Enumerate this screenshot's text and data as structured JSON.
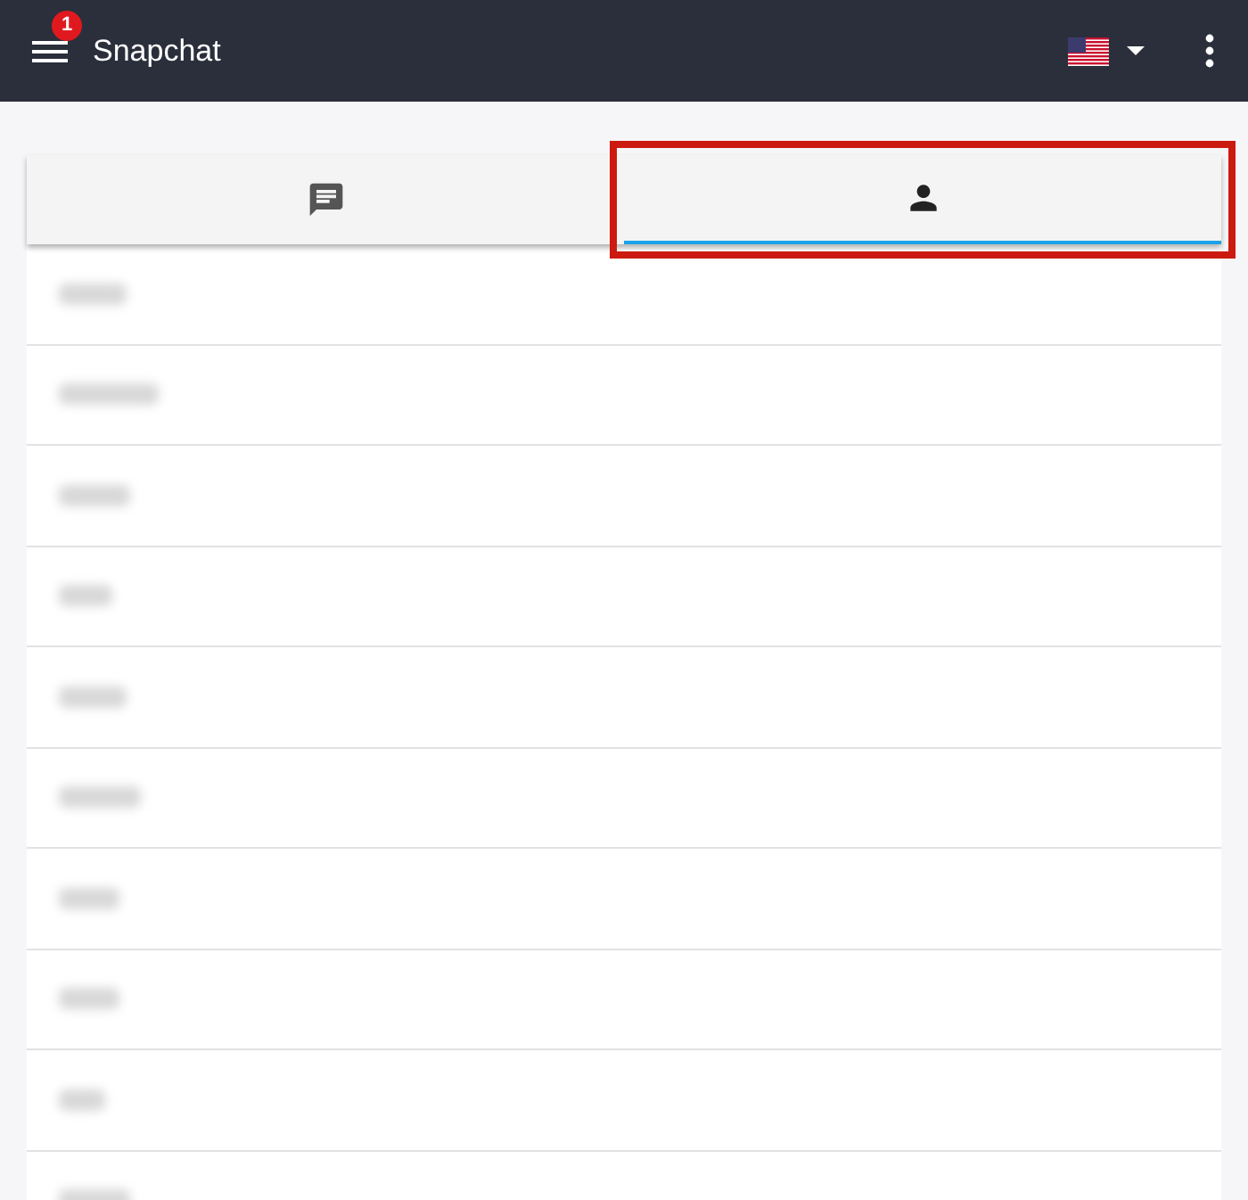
{
  "app_bar": {
    "title": "Snapchat",
    "menu_badge": "1"
  },
  "tabs": [
    {
      "kind": "chats",
      "selected": false,
      "highlighted": false
    },
    {
      "kind": "friends",
      "selected": true,
      "highlighted": true
    }
  ],
  "rows": [
    {
      "kind": "redacted"
    },
    {
      "kind": "redacted"
    },
    {
      "kind": "redacted"
    },
    {
      "kind": "redacted"
    },
    {
      "kind": "redacted"
    },
    {
      "kind": "redacted"
    },
    {
      "kind": "redacted"
    },
    {
      "kind": "redacted"
    },
    {
      "kind": "redacted"
    },
    {
      "kind": "redacted"
    }
  ]
}
